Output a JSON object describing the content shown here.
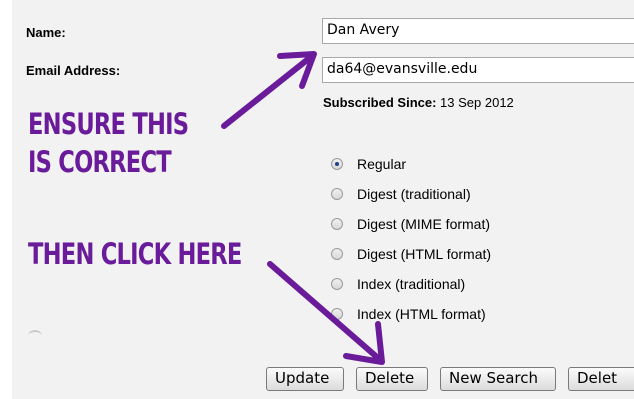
{
  "form": {
    "name_label": "Name:",
    "name_value": "Dan Avery",
    "email_label": "Email Address:",
    "email_value": "da64@evansville.edu",
    "subscribed_label": "Subscribed Since:",
    "subscribed_value": "13 Sep 2012"
  },
  "delivery_options": [
    {
      "label": "Regular",
      "selected": true
    },
    {
      "label": "Digest (traditional)",
      "selected": false
    },
    {
      "label": "Digest (MIME format)",
      "selected": false
    },
    {
      "label": "Digest (HTML format)",
      "selected": false
    },
    {
      "label": "Index (traditional)",
      "selected": false
    },
    {
      "label": "Index (HTML format)",
      "selected": false
    }
  ],
  "buttons": {
    "update": "Update",
    "delete": "Delete",
    "new_search": "New Search",
    "delete_cut": "Delet"
  },
  "annotations": {
    "line1": "ENSURE THIS",
    "line2": "IS CORRECT",
    "line3": "THEN CLICK HERE"
  },
  "colors": {
    "annotation": "#6a1b9a",
    "panel": "#f2f2f2"
  }
}
